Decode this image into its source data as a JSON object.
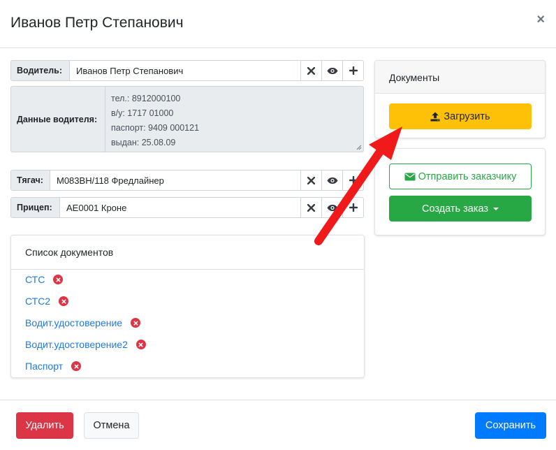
{
  "modal": {
    "title": "Иванов Петр Степанович",
    "close_glyph": "×"
  },
  "driver": {
    "label": "Водитель:",
    "value": "Иванов Петр Степанович"
  },
  "driver_data": {
    "label": "Данные водителя:",
    "lines": [
      "тел.: 8912000100",
      "в/у: 1717 01000",
      "паспорт: 9409 000121",
      "выдан: 25.08.09"
    ]
  },
  "tractor": {
    "label": "Тягач:",
    "value": "М083ВН/118 Фредлайнер"
  },
  "trailer": {
    "label": "Прицеп:",
    "value": "АЕ0001 Кроне"
  },
  "doc_list": {
    "title": "Список документов",
    "items": [
      "СТС",
      "СТС2",
      "Водит.удостоверение",
      "Водит.удостоверение2",
      "Паспорт"
    ]
  },
  "documents_panel": {
    "title": "Документы",
    "upload_label": "Загрузить"
  },
  "actions": {
    "send_label": "Отправить заказчику",
    "order_label": "Создать заказ"
  },
  "footer": {
    "delete_label": "Удалить",
    "cancel_label": "Отмена",
    "save_label": "Сохранить"
  },
  "colors": {
    "warning": "#ffc107",
    "success": "#28a745",
    "danger": "#dc3545",
    "primary": "#007bff",
    "link": "#1f7ae0",
    "annotation_arrow": "#f01a1a"
  },
  "icons": {
    "clear": "close-icon",
    "view": "eye-icon",
    "add": "plus-icon",
    "remove_doc": "remove-circle-icon",
    "upload": "upload-icon",
    "send": "envelope-icon",
    "dropdown": "caret-down-icon"
  }
}
